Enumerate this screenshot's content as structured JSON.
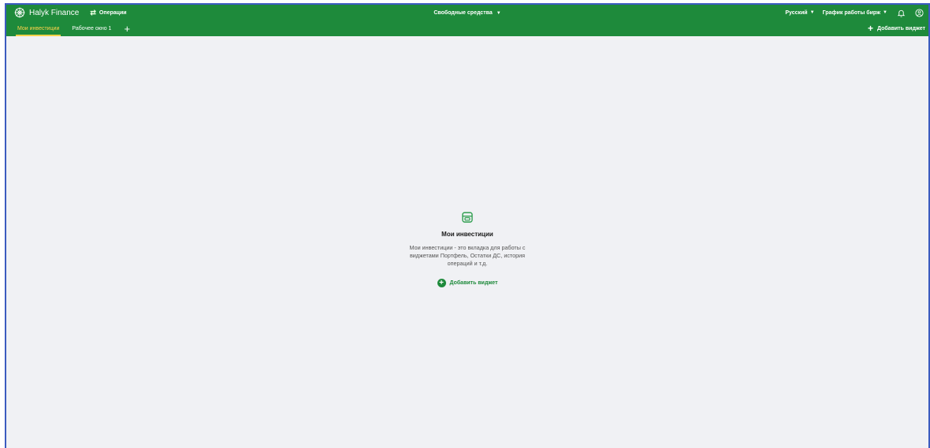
{
  "header": {
    "brand": "Halyk Finance",
    "operations_label": "Операции",
    "free_funds_label": "Свободные средства",
    "language_label": "Русский",
    "exchange_schedule_label": "График работы бирж",
    "accent_color": "#1e8a3b",
    "active_tab_color": "#ffd24a"
  },
  "tabs": [
    {
      "label": "Мои инвестиции",
      "active": true
    },
    {
      "label": "Рабочее окно 1",
      "active": false
    }
  ],
  "add_widget_top_label": "Добавить виджет",
  "empty_state": {
    "title": "Мои инвестиции",
    "description": "Мои инвестиции - это вкладка для работы с виджетами Портфель, Остатки ДС, история операций и т.д.",
    "action_label": "Добавить виджет"
  }
}
